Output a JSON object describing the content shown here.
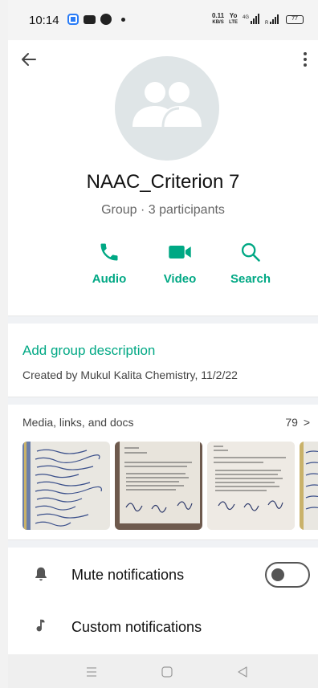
{
  "status_bar": {
    "time": "10:14",
    "speed_value": "0.11",
    "speed_unit": "KB/S",
    "volte_1": "Yo",
    "volte_2": "LTE",
    "net_type": "4G",
    "battery": "77"
  },
  "header": {
    "group_name": "NAAC_Criterion 7",
    "group_subtitle": "Group · 3 participants"
  },
  "actions": [
    {
      "label": "Audio",
      "icon": "phone-icon"
    },
    {
      "label": "Video",
      "icon": "video-camera-icon"
    },
    {
      "label": "Search",
      "icon": "search-icon"
    }
  ],
  "description": {
    "add_label": "Add group description",
    "created_by": "Created by Mukul Kalita Chemistry, 11/2/22"
  },
  "media": {
    "title": "Media, links, and docs",
    "count": "79",
    "arrow": ">"
  },
  "settings": [
    {
      "label": "Mute notifications",
      "icon": "bell-icon",
      "toggle": false
    },
    {
      "label": "Custom notifications",
      "icon": "music-note-icon"
    }
  ],
  "colors": {
    "accent": "#00a884",
    "avatar_bg": "#dfe5e7"
  }
}
